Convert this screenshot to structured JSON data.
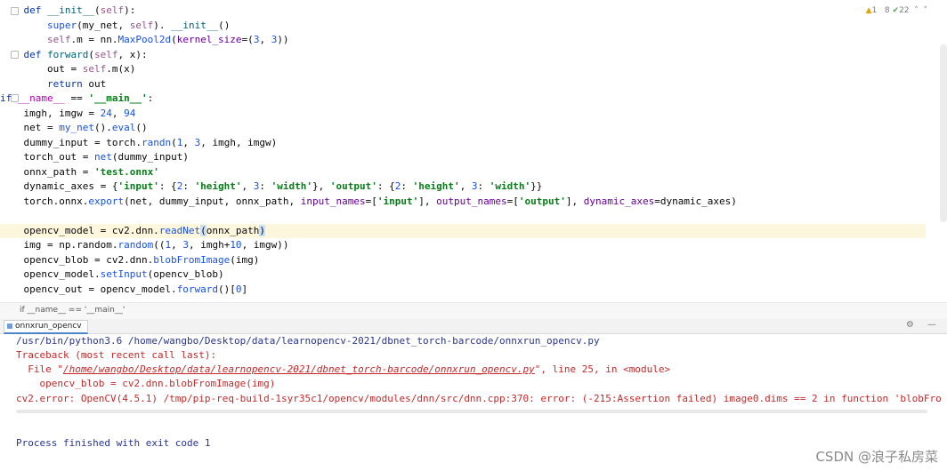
{
  "editor": {
    "inspection": {
      "warnings": "1",
      "weak_warnings": "8",
      "typos": "22",
      "up": "˄",
      "down": "˅"
    },
    "lines": [
      [
        [
          "kw",
          "    def "
        ],
        [
          "fn",
          "__init__"
        ],
        [
          "plain",
          "("
        ],
        [
          "slf",
          "self"
        ],
        [
          "plain",
          "):"
        ]
      ],
      [
        [
          "plain",
          "        "
        ],
        [
          "call",
          "super"
        ],
        [
          "plain",
          "(my_net, "
        ],
        [
          "slf",
          "self"
        ],
        [
          "plain",
          "). "
        ],
        [
          "fn",
          "__init__"
        ],
        [
          "plain",
          "()"
        ]
      ],
      [
        [
          "plain",
          "        "
        ],
        [
          "slf",
          "self"
        ],
        [
          "plain",
          ".m = nn."
        ],
        [
          "call",
          "MaxPool2d"
        ],
        [
          "plain",
          "("
        ],
        [
          "prm",
          "kernel_size"
        ],
        [
          "plain",
          "=("
        ],
        [
          "num",
          "3"
        ],
        [
          "plain",
          ", "
        ],
        [
          "num",
          "3"
        ],
        [
          "plain",
          "))"
        ]
      ],
      [
        [
          "kw",
          "    def "
        ],
        [
          "fn",
          "forward"
        ],
        [
          "plain",
          "("
        ],
        [
          "slf",
          "self"
        ],
        [
          "plain",
          ", x):"
        ]
      ],
      [
        [
          "plain",
          "        out = "
        ],
        [
          "slf",
          "self"
        ],
        [
          "plain",
          ".m(x)"
        ]
      ],
      [
        [
          "kw",
          "        return "
        ],
        [
          "plain",
          "out"
        ]
      ],
      [
        [
          "kw",
          "if "
        ],
        [
          "dun",
          "__name__"
        ],
        [
          "plain",
          " == "
        ],
        [
          "str",
          "'__main__'"
        ],
        [
          "plain",
          ":"
        ]
      ],
      [
        [
          "plain",
          "    imgh, imgw = "
        ],
        [
          "num",
          "24"
        ],
        [
          "plain",
          ", "
        ],
        [
          "num",
          "94"
        ]
      ],
      [
        [
          "plain",
          "    net = "
        ],
        [
          "call",
          "my_net"
        ],
        [
          "plain",
          "()."
        ],
        [
          "call",
          "eval"
        ],
        [
          "plain",
          "()"
        ]
      ],
      [
        [
          "plain",
          "    dummy_input = torch."
        ],
        [
          "call",
          "randn"
        ],
        [
          "plain",
          "("
        ],
        [
          "num",
          "1"
        ],
        [
          "plain",
          ", "
        ],
        [
          "num",
          "3"
        ],
        [
          "plain",
          ", imgh, imgw)"
        ]
      ],
      [
        [
          "plain",
          "    torch_out = "
        ],
        [
          "call",
          "net"
        ],
        [
          "plain",
          "(dummy_input)"
        ]
      ],
      [
        [
          "plain",
          "    onnx_path = "
        ],
        [
          "str",
          "'test.onnx'"
        ]
      ],
      [
        [
          "plain",
          "    dynamic_axes = {"
        ],
        [
          "str",
          "'input'"
        ],
        [
          "plain",
          ": {"
        ],
        [
          "num",
          "2"
        ],
        [
          "plain",
          ": "
        ],
        [
          "str",
          "'height'"
        ],
        [
          "plain",
          ", "
        ],
        [
          "num",
          "3"
        ],
        [
          "plain",
          ": "
        ],
        [
          "str",
          "'width'"
        ],
        [
          "plain",
          "}, "
        ],
        [
          "str",
          "'output'"
        ],
        [
          "plain",
          ": {"
        ],
        [
          "num",
          "2"
        ],
        [
          "plain",
          ": "
        ],
        [
          "str",
          "'height'"
        ],
        [
          "plain",
          ", "
        ],
        [
          "num",
          "3"
        ],
        [
          "plain",
          ": "
        ],
        [
          "str",
          "'width'"
        ],
        [
          "plain",
          "}}"
        ]
      ],
      [
        [
          "plain",
          "    torch.onnx."
        ],
        [
          "call",
          "export"
        ],
        [
          "plain",
          "(net, dummy_input, onnx_path, "
        ],
        [
          "prm",
          "input_names"
        ],
        [
          "plain",
          "=["
        ],
        [
          "str",
          "'input'"
        ],
        [
          "plain",
          "], "
        ],
        [
          "prm",
          "output_names"
        ],
        [
          "plain",
          "=["
        ],
        [
          "str",
          "'output'"
        ],
        [
          "plain",
          "], "
        ],
        [
          "prm",
          "dynamic_axes"
        ],
        [
          "plain",
          "=dynamic_axes)"
        ]
      ],
      [
        [
          "plain",
          ""
        ]
      ],
      [
        [
          "plain",
          "    opencv_model = cv2.dnn."
        ],
        [
          "call",
          "readNet"
        ],
        [
          "cursor-hl",
          "("
        ],
        [
          "plain",
          "onnx_path"
        ],
        [
          "cursor-hl",
          ")"
        ]
      ],
      [
        [
          "plain",
          "    img = np.random."
        ],
        [
          "call",
          "random"
        ],
        [
          "plain",
          "(("
        ],
        [
          "num",
          "1"
        ],
        [
          "plain",
          ", "
        ],
        [
          "num",
          "3"
        ],
        [
          "plain",
          ", imgh+"
        ],
        [
          "num",
          "10"
        ],
        [
          "plain",
          ", imgw))"
        ]
      ],
      [
        [
          "plain",
          "    opencv_blob = cv2.dnn."
        ],
        [
          "call",
          "blobFromImage"
        ],
        [
          "plain",
          "(img)"
        ]
      ],
      [
        [
          "plain",
          "    opencv_model."
        ],
        [
          "call",
          "setInput"
        ],
        [
          "plain",
          "(opencv_blob)"
        ]
      ],
      [
        [
          "plain",
          "    opencv_out = opencv_model."
        ],
        [
          "call",
          "forward"
        ],
        [
          "plain",
          "()["
        ],
        [
          "num",
          "0"
        ],
        [
          "plain",
          "]"
        ]
      ]
    ]
  },
  "breadcrumb": "if __name__ == '__main__'",
  "run": {
    "tab_label": "onnxrun_opencv",
    "tools": "⚙ —"
  },
  "console": {
    "cmd": "/usr/bin/python3.6 /home/wangbo/Desktop/data/learnopencv-2021/dbnet_torch-barcode/onnxrun_opencv.py",
    "traceback": "Traceback (most recent call last):",
    "file_prefix": "  File \"",
    "file_path": "/home/wangbo/Desktop/data/learnopencv-2021/dbnet_torch-barcode/onnxrun_opencv.py",
    "file_suffix": "\", line 25, in <module>",
    "code_line": "    opencv_blob = cv2.dnn.blobFromImage(img)",
    "error": "cv2.error: OpenCV(4.5.1) /tmp/pip-req-build-1syr35c1/opencv/modules/dnn/src/dnn.cpp:370: error: (-215:Assertion failed) image0.dims == 2 in function 'blobFro",
    "finished": "Process finished with exit code 1"
  },
  "watermark": "CSDN @浪子私房菜",
  "colors": {
    "highlight_line": "#fcf6dd",
    "error_red": "#c62828",
    "console_blue": "#283593"
  }
}
